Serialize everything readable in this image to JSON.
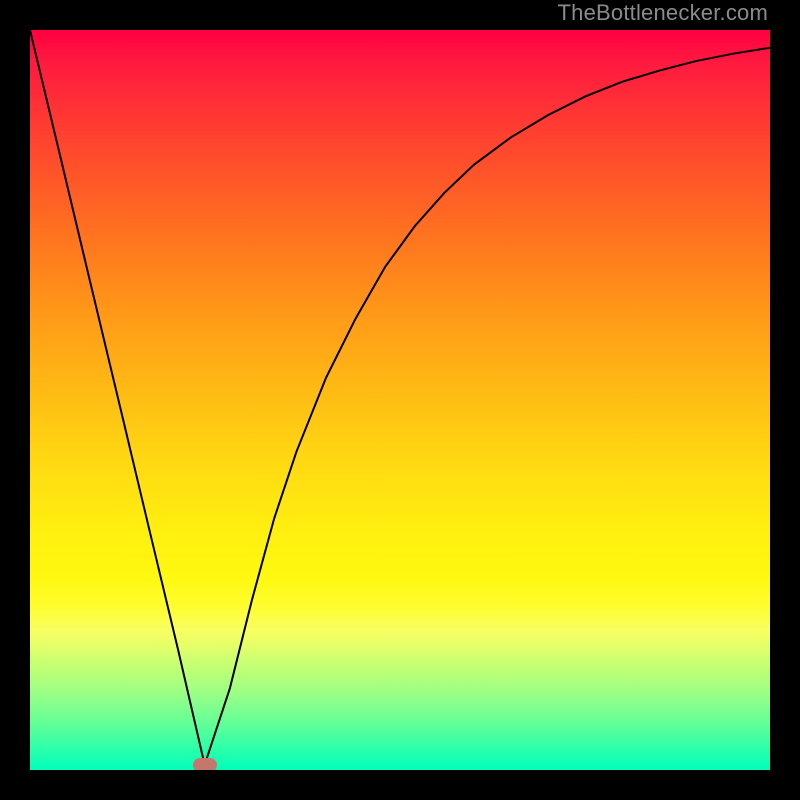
{
  "watermark": {
    "text": "TheBottlenecker.com"
  },
  "marker": {
    "x_fraction": 0.236,
    "y_fraction": 0.993,
    "color": "#c5776e"
  },
  "chart_data": {
    "type": "line",
    "title": "",
    "xlabel": "",
    "ylabel": "",
    "xlim": [
      0,
      1
    ],
    "ylim": [
      0,
      1
    ],
    "series": [
      {
        "name": "curve",
        "points": [
          {
            "x": 0.0,
            "y": 1.0
          },
          {
            "x": 0.04,
            "y": 0.833
          },
          {
            "x": 0.08,
            "y": 0.665
          },
          {
            "x": 0.12,
            "y": 0.498
          },
          {
            "x": 0.16,
            "y": 0.33
          },
          {
            "x": 0.2,
            "y": 0.163
          },
          {
            "x": 0.236,
            "y": 0.007
          },
          {
            "x": 0.27,
            "y": 0.11
          },
          {
            "x": 0.3,
            "y": 0.23
          },
          {
            "x": 0.33,
            "y": 0.34
          },
          {
            "x": 0.36,
            "y": 0.43
          },
          {
            "x": 0.4,
            "y": 0.53
          },
          {
            "x": 0.44,
            "y": 0.61
          },
          {
            "x": 0.48,
            "y": 0.68
          },
          {
            "x": 0.52,
            "y": 0.735
          },
          {
            "x": 0.56,
            "y": 0.78
          },
          {
            "x": 0.6,
            "y": 0.818
          },
          {
            "x": 0.65,
            "y": 0.855
          },
          {
            "x": 0.7,
            "y": 0.885
          },
          {
            "x": 0.75,
            "y": 0.91
          },
          {
            "x": 0.8,
            "y": 0.93
          },
          {
            "x": 0.85,
            "y": 0.945
          },
          {
            "x": 0.9,
            "y": 0.958
          },
          {
            "x": 0.95,
            "y": 0.968
          },
          {
            "x": 1.0,
            "y": 0.976
          }
        ]
      }
    ],
    "gradient_stops": [
      {
        "offset": 0.0,
        "color": "#ff0040"
      },
      {
        "offset": 0.14,
        "color": "#ff4030"
      },
      {
        "offset": 0.38,
        "color": "#ff9818"
      },
      {
        "offset": 0.58,
        "color": "#ffd810"
      },
      {
        "offset": 0.78,
        "color": "#fffd30"
      },
      {
        "offset": 0.9,
        "color": "#88ff8c"
      },
      {
        "offset": 1.0,
        "color": "#00ffba"
      }
    ],
    "marker_point": {
      "x": 0.236,
      "y": 0.007
    }
  }
}
